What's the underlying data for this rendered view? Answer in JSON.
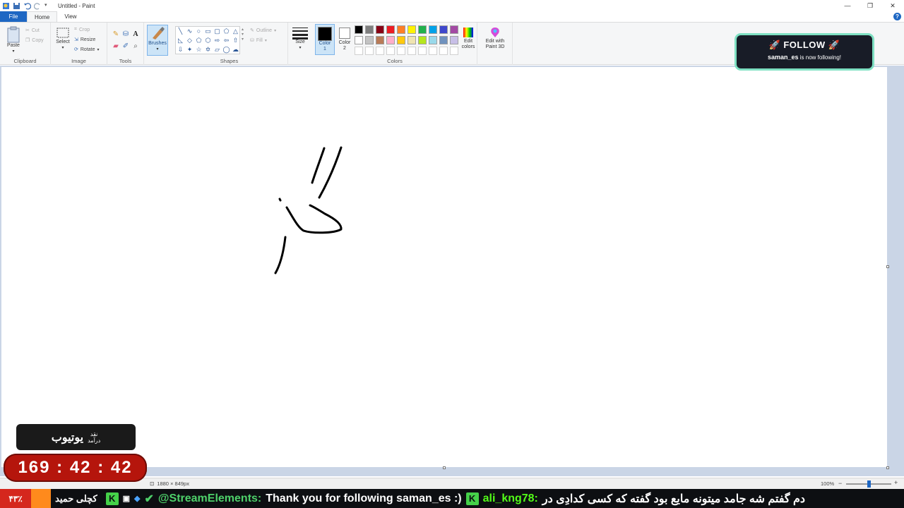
{
  "window": {
    "title": "Untitled - Paint",
    "buttons": {
      "minimize": "—",
      "maximize": "❐",
      "close": "✕"
    }
  },
  "tabs": {
    "file": "File",
    "home": "Home",
    "view": "View",
    "help": "?"
  },
  "ribbon": {
    "clipboard": {
      "label": "Clipboard",
      "paste": "Paste",
      "cut": "Cut",
      "copy": "Copy"
    },
    "image": {
      "label": "Image",
      "select": "Select",
      "crop": "Crop",
      "resize": "Resize",
      "rotate": "Rotate"
    },
    "tools": {
      "label": "Tools"
    },
    "brushes": {
      "label": "Brushes"
    },
    "shapes": {
      "label": "Shapes",
      "outline": "Outline",
      "fill": "Fill"
    },
    "size": {
      "label": "Size"
    },
    "color1": {
      "label": "Color\n1"
    },
    "color2": {
      "label": "Color\n2"
    },
    "colors": {
      "label": "Colors",
      "palette_row1": [
        "#000000",
        "#7f7f7f",
        "#880015",
        "#ed1c24",
        "#ff7f27",
        "#fff200",
        "#22b14c",
        "#00a2e8",
        "#3f48cc",
        "#a349a4"
      ],
      "palette_row2": [
        "#ffffff",
        "#c3c3c3",
        "#b97a57",
        "#ffaec9",
        "#ffc90e",
        "#efe4b0",
        "#b5e61d",
        "#99d9ea",
        "#7092be",
        "#c8bfe7"
      ],
      "edit_colors": "Edit\ncolors"
    },
    "paint3d": {
      "label": "Edit with\nPaint 3D"
    }
  },
  "status": {
    "dimensions": "1880 × 849px",
    "zoom": "100%"
  },
  "follow_alert": {
    "heading": "🚀 FOLLOW 🚀",
    "user": "saman_es",
    "text": "is now following!"
  },
  "stream_overlay": {
    "yt_big": "یوتیوب",
    "yt_small_1": "نقد",
    "yt_small_2": "درآمد",
    "timer": "169 : 42 : 42"
  },
  "ticker": {
    "percent": "۴۳٪",
    "name": "کچلی حمید",
    "bot": "@StreamElements:",
    "message": "Thank you for following saman_es :)",
    "user": "ali_kng78:",
    "user_message": "دم گفتم شه جامد میتونه مایع بود گفته که کسی کدادِی در"
  }
}
